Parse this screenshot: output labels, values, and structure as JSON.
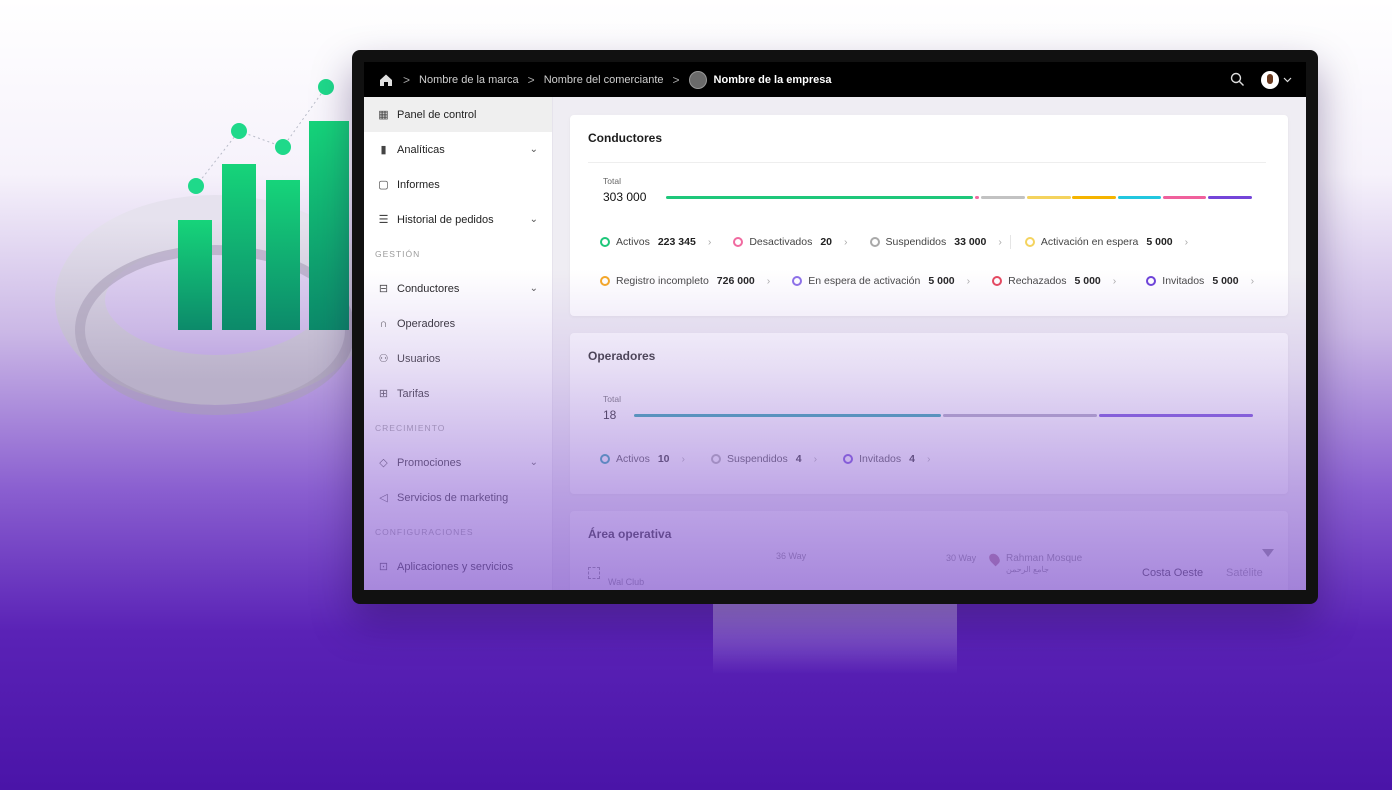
{
  "breadcrumb": {
    "brand": "Nombre de la marca",
    "merchant": "Nombre del comerciante",
    "company": "Nombre de la empresa"
  },
  "sidebar": {
    "items_top": [
      {
        "label": "Panel de control",
        "icon": "dashboard-icon",
        "active": true
      },
      {
        "label": "Analíticas",
        "icon": "analytics-icon",
        "expandable": true
      },
      {
        "label": "Informes",
        "icon": "reports-icon"
      },
      {
        "label": "Historial de pedidos",
        "icon": "orders-history-icon",
        "expandable": true
      }
    ],
    "section_gestion": "GESTIÓN",
    "items_gestion": [
      {
        "label": "Conductores",
        "icon": "car-icon",
        "expandable": true
      },
      {
        "label": "Operadores",
        "icon": "headset-icon"
      },
      {
        "label": "Usuarios",
        "icon": "users-icon"
      },
      {
        "label": "Tarifas",
        "icon": "tariffs-icon"
      }
    ],
    "section_crecimiento": "CRECIMIENTO",
    "items_crecimiento": [
      {
        "label": "Promociones",
        "icon": "tag-icon",
        "expandable": true
      },
      {
        "label": "Servicios de marketing",
        "icon": "megaphone-icon"
      }
    ],
    "section_config": "CONFIGURACIONES",
    "items_config": [
      {
        "label": "Aplicaciones y servicios",
        "icon": "apps-icon"
      }
    ]
  },
  "drivers": {
    "title": "Conductores",
    "total_label": "Total",
    "total_value": "303 000",
    "statuses": [
      {
        "label": "Activos",
        "value": "223 345",
        "color": "#1ec77a"
      },
      {
        "label": "Desactivados",
        "value": "20",
        "color": "#f06aa0"
      },
      {
        "label": "Suspendidos",
        "value": "33 000",
        "color": "#a9a9a9"
      },
      {
        "label": "Activación en espera",
        "value": "5 000",
        "color": "#f4d35e"
      },
      {
        "label": "Registro incompleto",
        "value": "726 000",
        "color": "#f5a623"
      },
      {
        "label": "En espera de activación",
        "value": "5 000",
        "color": "#8b6ee8"
      },
      {
        "label": "Rechazados",
        "value": "5 000",
        "color": "#e5455c"
      },
      {
        "label": "Invitados",
        "value": "5 000",
        "color": "#6a3fd8"
      }
    ],
    "bar_colors": [
      "#1ec77a",
      "#f06aa0",
      "#c2c2c2",
      "#f4d35e",
      "#f5b400",
      "#22c7df",
      "#f0609c",
      "#7445d9"
    ]
  },
  "operators": {
    "title": "Operadores",
    "total_label": "Total",
    "total_value": "18",
    "statuses": [
      {
        "label": "Activos",
        "value": "10",
        "color": "#1a9ca6"
      },
      {
        "label": "Suspendidos",
        "value": "4",
        "color": "#a9a9a9"
      },
      {
        "label": "Invitados",
        "value": "4",
        "color": "#6a3fd8"
      }
    ],
    "bar_colors": [
      "#1a9ca6",
      "#a9a1bd",
      "#6a3fd8"
    ]
  },
  "area": {
    "title": "Área operativa",
    "map_labels": {
      "street1": "36 Way",
      "street2": "30 Way",
      "poi": "Rahman Mosque",
      "poi_ar": "جامع الرحمن",
      "area": "Wal Club"
    },
    "view_options": [
      "Costa Oeste",
      "Satélite"
    ]
  }
}
